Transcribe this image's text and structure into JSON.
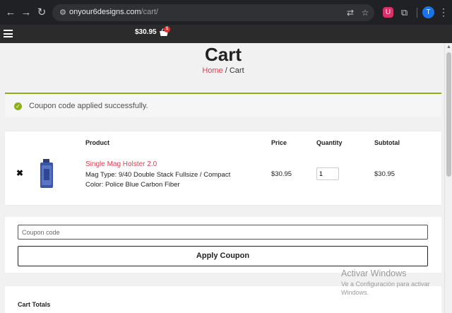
{
  "browser": {
    "url_domain": "onyour6designs.com",
    "url_path": "/cart/",
    "profile_initial": "T",
    "extension_badge": "U",
    "icons": [
      "back-icon",
      "forward-icon",
      "reload-icon",
      "tune-icon",
      "translate-icon",
      "star-icon",
      "extensions-icon",
      "menu-kebab-icon"
    ]
  },
  "header": {
    "cart_total": "$30.95",
    "cart_count": "1"
  },
  "page": {
    "title": "Cart",
    "breadcrumb_home": "Home",
    "breadcrumb_sep": " / ",
    "breadcrumb_current": "Cart"
  },
  "notice": {
    "message": "Coupon code applied successfully."
  },
  "cart_table": {
    "headers": {
      "product": "Product",
      "price": "Price",
      "quantity": "Quantity",
      "subtotal": "Subtotal"
    },
    "item": {
      "remove": "✖",
      "name": "Single Mag Holster 2.0",
      "mag_type": "Mag Type: 9/40 Double Stack Fullsize / Compact",
      "color": "Color: Police Blue Carbon Fiber",
      "price": "$30.95",
      "quantity": "1",
      "subtotal": "$30.95"
    }
  },
  "coupon": {
    "placeholder": "Coupon code",
    "apply_label": "Apply Coupon"
  },
  "totals": {
    "title": "Cart Totals"
  },
  "watermark": {
    "title": "Activar Windows",
    "subtitle_line1": "Ve a Configuración para activar",
    "subtitle_line2": "Windows."
  },
  "colors": {
    "accent_pink": "#e03e52",
    "success_green": "#8fae1b",
    "header_bg": "#2b2b2b"
  }
}
